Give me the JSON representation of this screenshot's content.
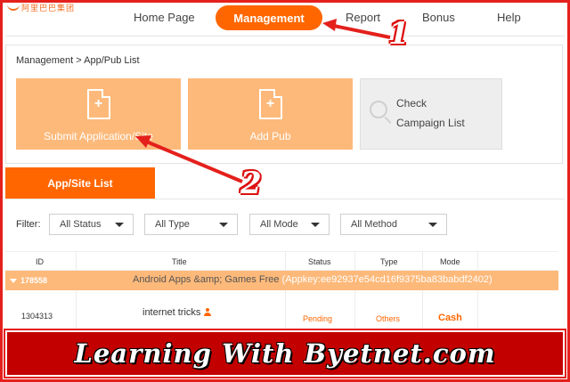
{
  "nav": {
    "logo_text": "阿里巴巴集团",
    "items": [
      "Home Page",
      "Management",
      "Report",
      "Bonus",
      "Help"
    ],
    "active": "Management"
  },
  "breadcrumb": "Management > App/Pub List",
  "actions": {
    "submit": "Submit Application/Site",
    "add_pub": "Add Pub",
    "check_line1": "Check",
    "check_line2": "Campaign List"
  },
  "list_tab": "App/Site List",
  "filter": {
    "label": "Filter:",
    "status": "All Status",
    "type": "All Type",
    "mode": "All Mode",
    "method": "All Method"
  },
  "table": {
    "headers": {
      "id": "ID",
      "title": "Title",
      "status": "Status",
      "type": "Type",
      "mode": "Mode"
    },
    "group": {
      "id": "178558",
      "title": "Android Apps &amp; Games Free",
      "appkey": "(Appkey:ee92937e54cd16f9375ba83babdf2402)"
    },
    "row": {
      "id": "1304313",
      "title": "internet tricks",
      "status": "Pending",
      "type": "Others",
      "mode": "Cash"
    }
  },
  "annotations": {
    "one": "1",
    "two": "2"
  },
  "banner": "Learning With Byetnet.com",
  "colors": {
    "accent": "#ff6600",
    "tile": "#fdb97a",
    "annotation_red": "#e4201c",
    "banner_red": "#c30000"
  }
}
